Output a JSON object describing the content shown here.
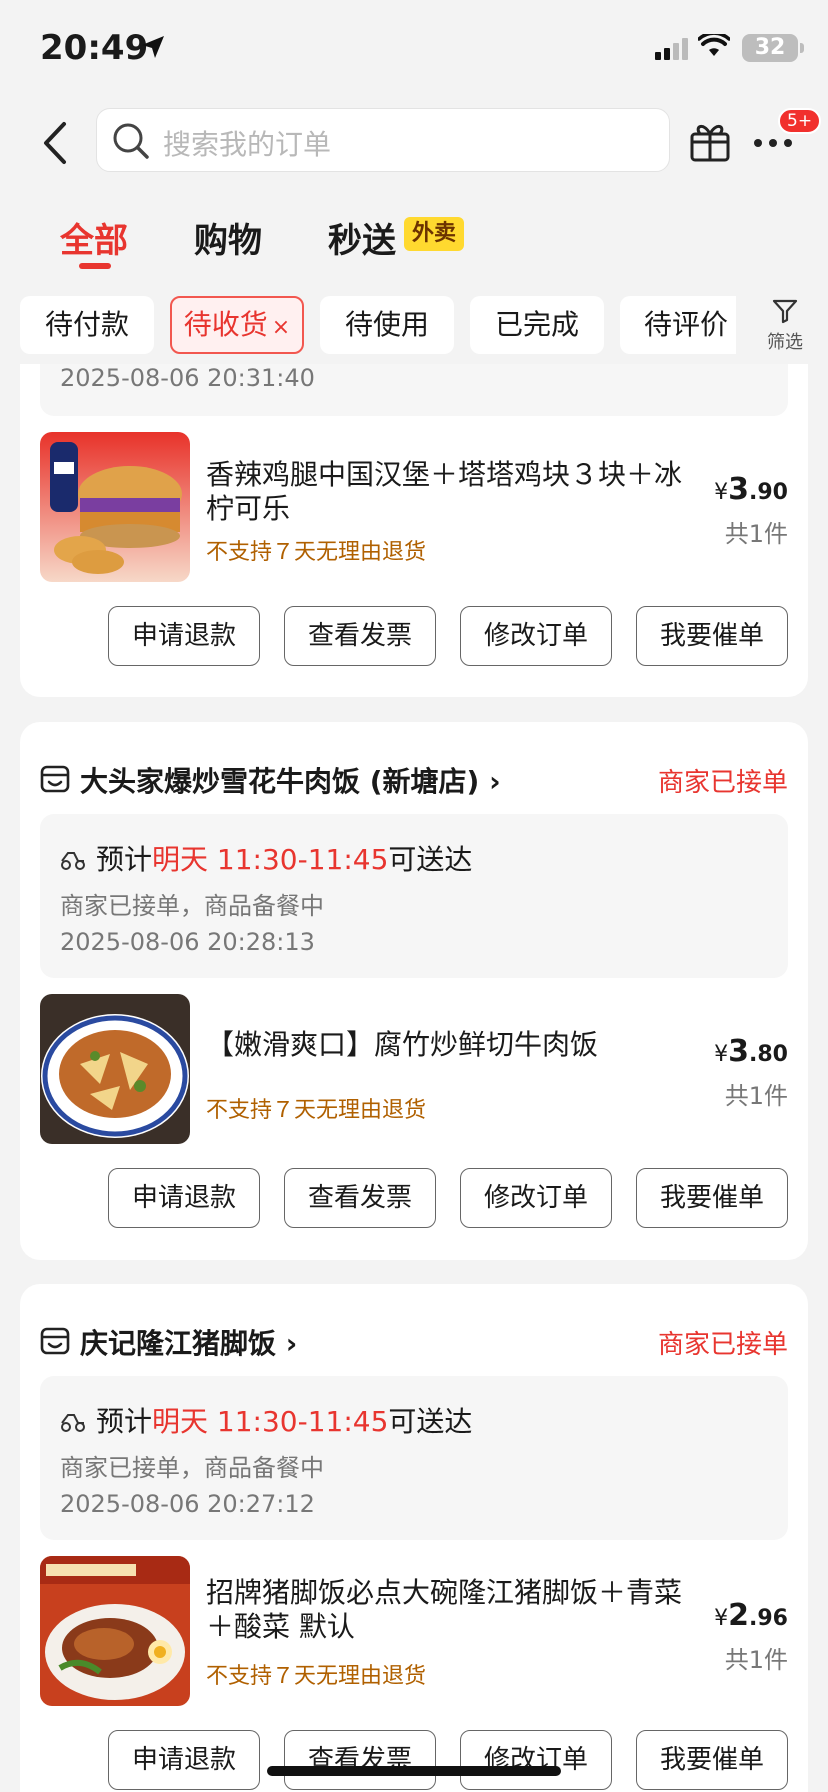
{
  "status": {
    "time": "20:49",
    "battery": "32"
  },
  "search": {
    "placeholder": "搜索我的订单"
  },
  "notifications": {
    "badge": "5+"
  },
  "tabs": [
    {
      "label": "全部",
      "active": true
    },
    {
      "label": "购物",
      "active": false
    },
    {
      "label": "秒送",
      "active": false,
      "tag": "外卖"
    }
  ],
  "chips": [
    {
      "label": "待付款"
    },
    {
      "label": "待收货",
      "active": true,
      "clear": "×"
    },
    {
      "label": "待使用"
    },
    {
      "label": "已完成"
    },
    {
      "label": "待评价"
    }
  ],
  "filter": {
    "label": "筛选"
  },
  "orders": [
    {
      "timestamp": "2025-08-06 20:31:40",
      "product": {
        "name": "香辣鸡腿中国汉堡＋塔塔鸡块３块＋冰柠可乐",
        "policy": "不支持７天无理由退货",
        "currency": "¥",
        "price_int": "3",
        "price_dec": ".90",
        "qty": "共1件"
      },
      "buttons": [
        "申请退款",
        "查看发票",
        "修改订单",
        "我要催单"
      ]
    },
    {
      "shop": "大头家爆炒雪花牛肉饭 (新塘店)",
      "status": "商家已接单",
      "eta_prefix": "预计",
      "eta_time": "明天 11:30-11:45",
      "eta_suffix": "可送达",
      "progress": "商家已接单，商品备餐中",
      "timestamp": "2025-08-06 20:28:13",
      "product": {
        "name": "【嫩滑爽口】腐竹炒鲜切牛肉饭",
        "policy": "不支持７天无理由退货",
        "currency": "¥",
        "price_int": "3",
        "price_dec": ".80",
        "qty": "共1件"
      },
      "buttons": [
        "申请退款",
        "查看发票",
        "修改订单",
        "我要催单"
      ]
    },
    {
      "shop": "庆记隆江猪脚饭",
      "status": "商家已接单",
      "eta_prefix": "预计",
      "eta_time": "明天 11:30-11:45",
      "eta_suffix": "可送达",
      "progress": "商家已接单，商品备餐中",
      "timestamp": "2025-08-06 20:27:12",
      "product": {
        "name": "招牌猪脚饭必点大碗隆江猪脚饭＋青菜＋酸菜 默认",
        "policy": "不支持７天无理由退货",
        "currency": "¥",
        "price_int": "2",
        "price_dec": ".96",
        "qty": "共1件"
      },
      "buttons": [
        "申请退款",
        "查看发票",
        "修改订单",
        "我要催单"
      ]
    }
  ],
  "colors": {
    "accent": "#e8352f",
    "policy": "#b06000",
    "background": "#f3f3f3"
  }
}
